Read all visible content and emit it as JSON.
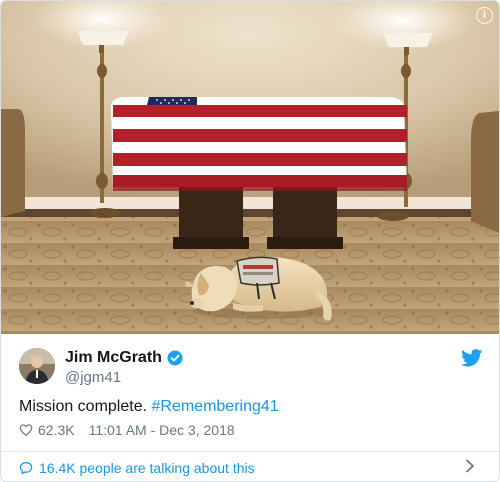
{
  "tweet": {
    "author_name": "Jim McGrath",
    "handle": "@jgm41",
    "text_plain": "Mission complete.",
    "hashtag": "#Remembering41",
    "likes": "62.3K",
    "timestamp": "11:01 AM - Dec 3, 2018",
    "footer_text": "16.4K people are talking about this",
    "info_glyph": "i"
  },
  "icons": {
    "verified": "verified-badge-icon",
    "bird": "twitter-bird-icon",
    "heart": "heart-outline-icon",
    "bubble": "speech-bubble-icon",
    "chevron": "chevron-right-icon",
    "info": "info-icon"
  },
  "colors": {
    "accent": "#1b95e0",
    "text": "#14171a",
    "muted": "#657786",
    "border": "#e6ecf0"
  }
}
